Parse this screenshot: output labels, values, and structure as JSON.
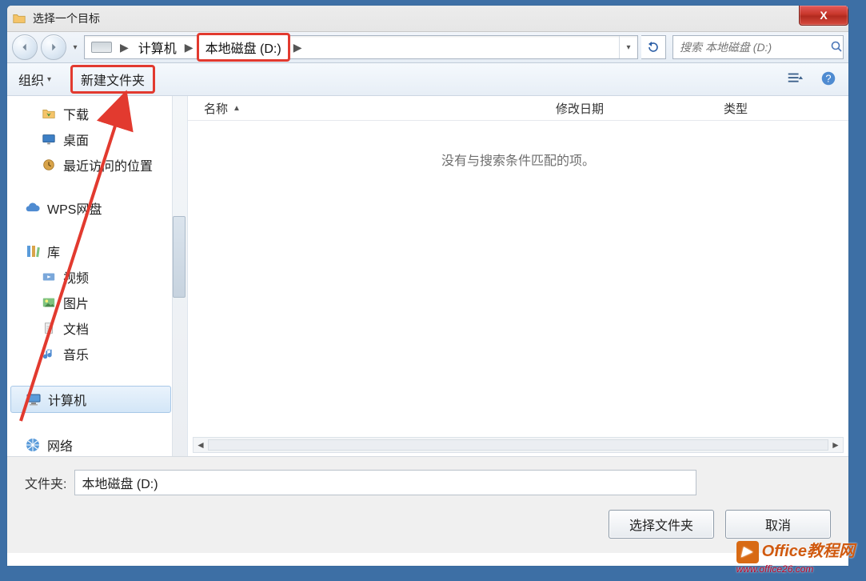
{
  "title": "选择一个目标",
  "close_glyph": "X",
  "nav": {
    "computer": "计算机",
    "drive": "本地磁盘 (D:)"
  },
  "search": {
    "placeholder": "搜索 本地磁盘 (D:)"
  },
  "toolbar": {
    "organize": "组织",
    "new_folder": "新建文件夹"
  },
  "sidebar": {
    "downloads": "下载",
    "desktop": "桌面",
    "recent": "最近访问的位置",
    "wps": "WPS网盘",
    "libraries": "库",
    "video": "视频",
    "pictures": "图片",
    "documents": "文档",
    "music": "音乐",
    "computer": "计算机",
    "network": "网络"
  },
  "columns": {
    "name": "名称",
    "modified": "修改日期",
    "type": "类型"
  },
  "empty_text": "没有与搜索条件匹配的项。",
  "footer": {
    "folder_label": "文件夹:",
    "folder_value": "本地磁盘 (D:)",
    "select_btn": "选择文件夹",
    "cancel_btn": "取消"
  },
  "watermark": {
    "line1": "Office教程网",
    "line2": "www.office26.com"
  }
}
